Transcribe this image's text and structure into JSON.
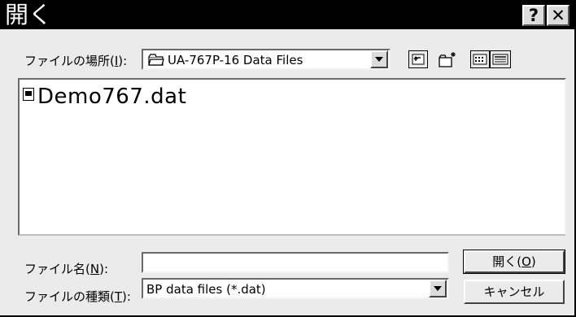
{
  "window": {
    "title": "開く",
    "help_label": "?",
    "close_label": "✕"
  },
  "location": {
    "label": "ファイルの場所(",
    "accesskey": "I",
    "label_end": "):",
    "value": "UA-767P-16 Data Files"
  },
  "toolbar": {
    "icons": [
      "up-one-level-icon",
      "new-folder-icon",
      "list-view-icon",
      "details-view-icon"
    ]
  },
  "files": [
    {
      "name": "Demo767.dat"
    }
  ],
  "filename": {
    "label": "ファイル名(",
    "accesskey": "N",
    "label_end": "):",
    "value": ""
  },
  "filetype": {
    "label": "ファイルの種類(",
    "accesskey": "T",
    "label_end": "):",
    "value": "BP data files (*.dat)"
  },
  "buttons": {
    "open_label": "開く(",
    "open_key": "O",
    "open_end": ")",
    "cancel_label": "キャンセル"
  }
}
